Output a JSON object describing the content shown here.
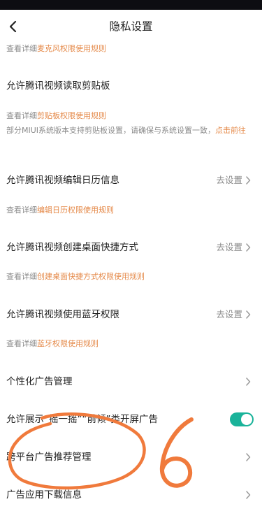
{
  "header": {
    "title": "隐私设置"
  },
  "rows": [
    {
      "info": [
        {
          "text": "查看详细"
        },
        {
          "text": "麦克风权限使用规则",
          "link": true
        }
      ]
    },
    {
      "label": "允许腾讯视频读取剪贴板"
    },
    {
      "info": [
        {
          "text": "查看详细"
        },
        {
          "text": "剪贴板权限使用规则",
          "link": true
        }
      ]
    },
    {
      "note": [
        {
          "text": "部分MIUI系统版本支持剪贴板设置，请确保与系统设置一致，"
        },
        {
          "text": "点击前往",
          "link": true
        }
      ]
    },
    {
      "label": "允许腾讯视频编辑日历信息",
      "action": "去设置"
    },
    {
      "info": [
        {
          "text": "查看详细"
        },
        {
          "text": "编辑日历权限使用规则",
          "link": true
        }
      ]
    },
    {
      "label": "允许腾讯视频创建桌面快捷方式",
      "action": "去设置"
    },
    {
      "info": [
        {
          "text": "查看详细"
        },
        {
          "text": "创建桌面快捷方式权限使用规则",
          "link": true
        }
      ]
    },
    {
      "label": "允许腾讯视频使用蓝牙权限",
      "action": "去设置"
    },
    {
      "info": [
        {
          "text": "查看详细"
        },
        {
          "text": "蓝牙权限使用规则",
          "link": true
        }
      ]
    },
    {
      "label": "个性化广告管理"
    },
    {
      "label": "允许展示“摇一摇”“前倾”类开屏广告",
      "toggle": true
    },
    {
      "label": "跨平台广告推荐管理"
    },
    {
      "label": "广告应用下载信息"
    }
  ],
  "colors": {
    "accent_link": "#e58a4a",
    "toggle_on": "#1ab39a",
    "scribble": "#f07a3c"
  }
}
